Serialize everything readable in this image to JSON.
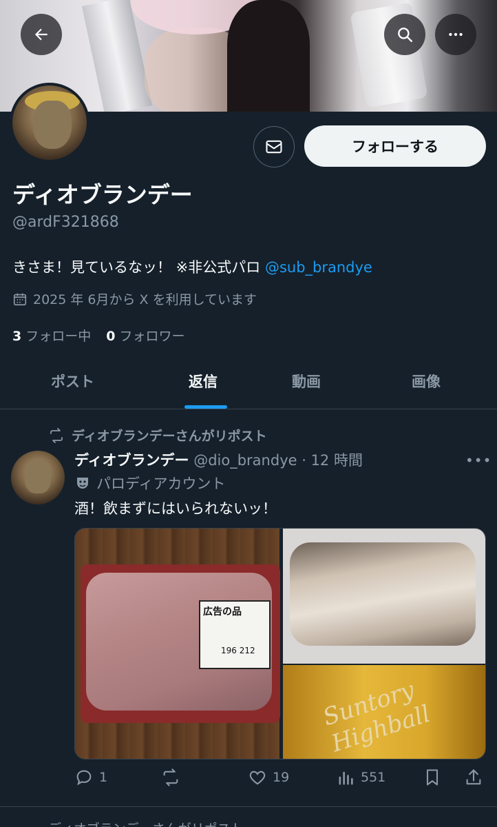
{
  "profile": {
    "display_name": "ディオブランデー",
    "handle": "@ardF321868",
    "bio_text": "きさま！見ているなッ！ ※非公式パロ ",
    "bio_mention": "@sub_brandye",
    "joined": "2025 年 6月から X を利用しています",
    "following_count": "3",
    "following_label": "フォロー中",
    "followers_count": "0",
    "followers_label": "フォロワー",
    "follow_button": "フォローする"
  },
  "tabs": [
    {
      "label": "ポスト"
    },
    {
      "label": "返信"
    },
    {
      "label": "動画"
    },
    {
      "label": "画像"
    }
  ],
  "active_tab": "返信",
  "tweet": {
    "repost_notice": "ディオブランデーさんがリポスト",
    "author_name": "ディオブランデー",
    "author_meta": " @dio_brandye · 12 時間",
    "parody_label": "パロディアカウント",
    "text": "酒！飲まずにはいられないッ！",
    "media_label_left": "広告の品",
    "media_label_price": "196 212",
    "media_can_text": "Suntory Highball",
    "replies": "1",
    "reposts": "",
    "likes": "19",
    "views": "551"
  },
  "next_repost": "ディオブランデーさんがリポスト",
  "colors": {
    "background": "#15202b",
    "accent": "#1d9bf0",
    "muted": "#8b98a5"
  },
  "icons": {
    "back": "arrow-left-icon",
    "search": "search-icon",
    "more": "more-horizontal-icon",
    "mail": "mail-icon",
    "calendar": "calendar-icon",
    "repost": "repost-icon",
    "parody": "mask-icon",
    "reply": "reply-icon",
    "like": "heart-icon",
    "views": "views-icon",
    "bookmark": "bookmark-icon",
    "share": "share-icon"
  }
}
